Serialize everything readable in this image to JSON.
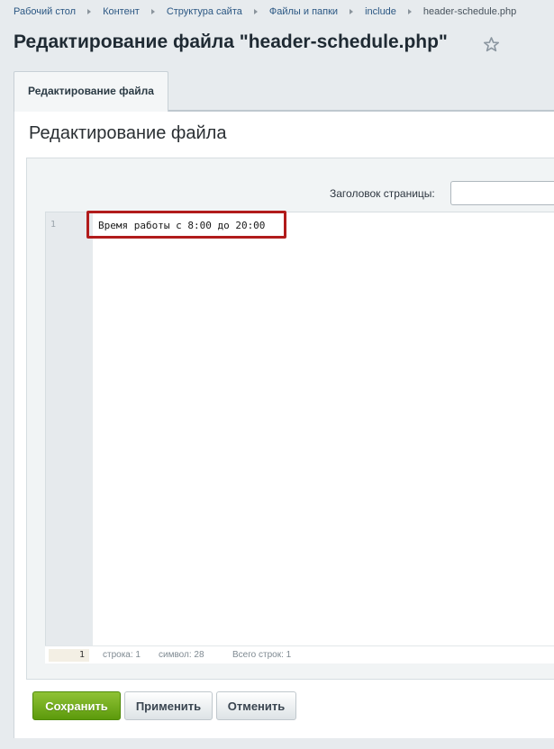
{
  "breadcrumb": {
    "items": [
      "Рабочий стол",
      "Контент",
      "Структура сайта",
      "Файлы и папки",
      "include",
      "header-schedule.php"
    ]
  },
  "page_title": "Редактирование файла \"header-schedule.php\"",
  "tabs": [
    {
      "label": "Редактирование файла",
      "active": true
    }
  ],
  "panel": {
    "title": "Редактирование файла"
  },
  "form": {
    "title_label": "Заголовок страницы:",
    "title_value": ""
  },
  "editor": {
    "lines": [
      {
        "number": "1",
        "text": "Время работы с 8:00 до 20:00"
      }
    ],
    "status": {
      "current_line": "1",
      "position": "строка: 1",
      "symbol": "символ: 28",
      "total": "Всего строк: 1"
    }
  },
  "buttons": {
    "save": "Сохранить",
    "apply": "Применить",
    "cancel": "Отменить"
  },
  "colors": {
    "accent_green": "#6aa619",
    "highlight_red": "#b11b1b",
    "link": "#2b5783"
  },
  "icons": {
    "favorite": "star-outline"
  }
}
